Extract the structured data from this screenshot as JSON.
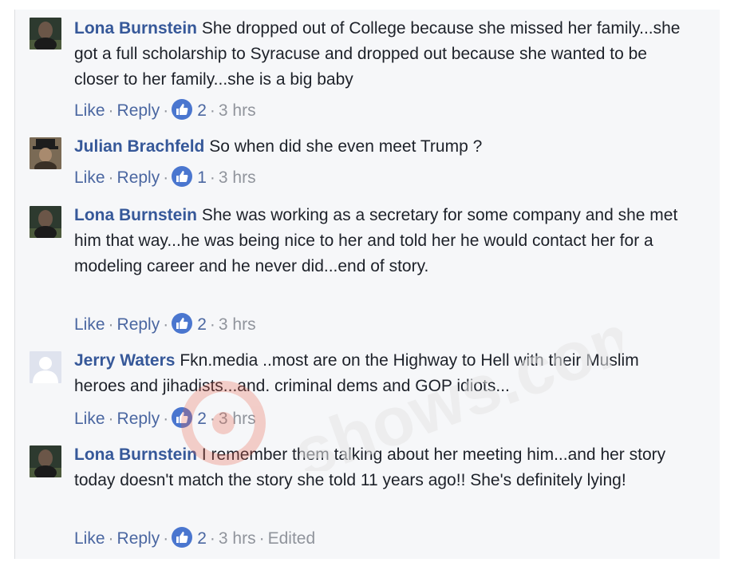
{
  "comments": [
    {
      "author": "Lona Burnstein",
      "text": "She dropped out of College because she missed her family...she got a full scholarship to Syracuse and dropped out because she wanted to be closer to her family...she is a big baby",
      "like_label": "Like",
      "reply_label": "Reply",
      "reaction_count": "2",
      "time": "3 hrs",
      "avatar_icon": "user-photo-icon"
    },
    {
      "author": "Julian Brachfeld",
      "text": "So when did she even meet Trump ?",
      "like_label": "Like",
      "reply_label": "Reply",
      "reaction_count": "1",
      "time": "3 hrs",
      "avatar_icon": "user-photo-icon"
    },
    {
      "author": "Lona Burnstein",
      "text": "She was working as a secretary for some company and she met him that way...he was being nice to her and told her he would contact her for a modeling career and he never did...end of story.",
      "like_label": "Like",
      "reply_label": "Reply",
      "reaction_count": "2",
      "time": "3 hrs",
      "avatar_icon": "user-photo-icon"
    },
    {
      "author": "Jerry Waters",
      "text": "Fkn.media ..most are on the Highway to Hell with their Muslim heroes and jihadists...and. criminal dems and GOP idiots...",
      "like_label": "Like",
      "reply_label": "Reply",
      "reaction_count": "2",
      "time": "3 hrs",
      "avatar_icon": "default-avatar-icon"
    },
    {
      "author": "Lona Burnstein",
      "text": "I remember them talking about her meeting him...and her story today doesn't match the story she told 11 years ago!! She's definitely lying!",
      "like_label": "Like",
      "reply_label": "Reply",
      "reaction_count": "2",
      "time": "3 hrs",
      "edited_label": "Edited",
      "avatar_icon": "user-photo-icon"
    }
  ],
  "watermark": {
    "text": "shows.com"
  },
  "colors": {
    "name": "#365899",
    "link": "#4b67a1",
    "meta": "#90949c",
    "like_blue": "#4a76cf",
    "panel_bg": "#f6f7f9",
    "watermark": "#e8604a"
  }
}
